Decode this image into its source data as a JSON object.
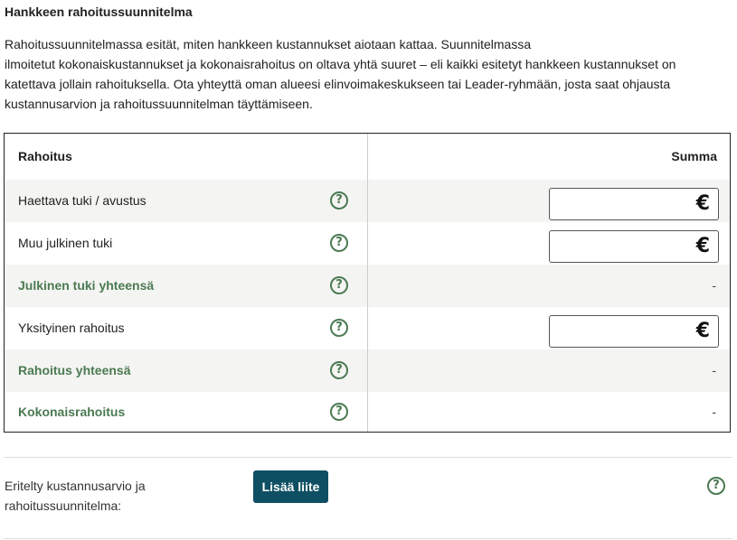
{
  "section": {
    "title": "Hankkeen rahoitussuunnitelma",
    "intro_lines": [
      "Rahoitussuunnitelmassa esität, miten hankkeen kustannukset aiotaan kattaa. Suunnitelmassa",
      "ilmoitetut kokonaiskustannukset ja kokonaisrahoitus on oltava yhtä suuret – eli kaikki esitetyt hankkeen kustannukset on",
      "katettava jollain rahoituksella. Ota yhteyttä oman alueesi elinvoimakeskukseen tai Leader-ryhmään, josta saat ohjausta",
      "kustannusarvion ja rahoitussuunnitelman täyttämiseen."
    ]
  },
  "table": {
    "header": {
      "label": "Rahoitus",
      "sum": "Summa"
    },
    "rows": [
      {
        "label": "Haettava tuki / avustus",
        "value": "",
        "currency": "€"
      },
      {
        "label": "Muu julkinen tuki",
        "value": "",
        "currency": "€"
      },
      {
        "label": "Julkinen tuki yhteensä",
        "total": "-"
      },
      {
        "label": "Yksityinen rahoitus",
        "value": "",
        "currency": "€"
      },
      {
        "label": "Rahoitus yhteensä",
        "total": "-"
      },
      {
        "label": "Kokonaisrahoitus",
        "total": "-"
      }
    ],
    "help_glyph": "?"
  },
  "attachment": {
    "label": "Eritelty kustannusarvio ja rahoitussuunnitelma:",
    "button_label": "Lisää liite"
  },
  "colors": {
    "accent_green": "#4b7a52",
    "button_blue": "#0f4f63",
    "row_alt_bg": "#f4f4f2"
  }
}
